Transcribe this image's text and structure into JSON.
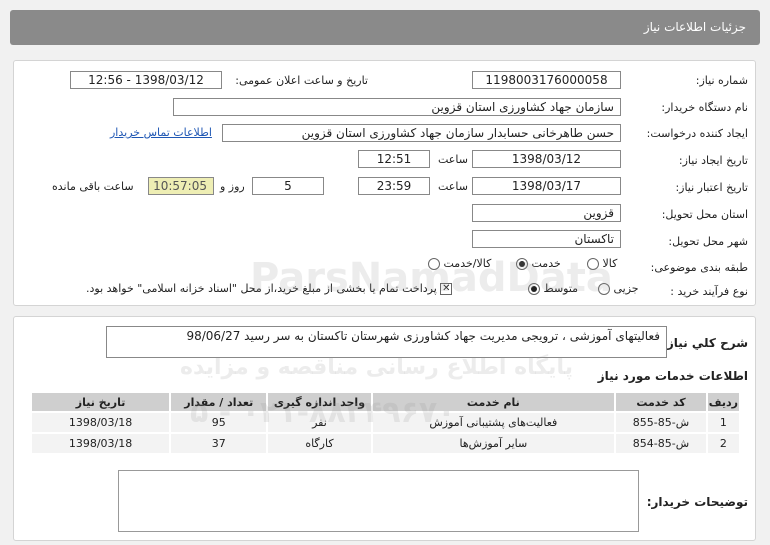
{
  "header": {
    "title": "جزئیات اطلاعات نیاز"
  },
  "info": {
    "need_number_label": "شماره نیاز:",
    "need_number": "1198003176000058",
    "announce_label": "تاریخ و ساعت اعلان عمومی:",
    "announce_value": "1398/03/12 - 12:56",
    "buyer_org_label": "نام دستگاه خریدار:",
    "buyer_org": "سازمان جهاد کشاورزی استان قزوین",
    "creator_label": "ایجاد کننده درخواست:",
    "creator": "حسن طاهرخانی حسابدار سازمان جهاد کشاورزی استان قزوین",
    "contact_link": "اطلاعات تماس خریدار",
    "created_label": "تاریخ ایجاد نیاز:",
    "created_date": "1398/03/12",
    "time_label": "ساعت",
    "created_time": "12:51",
    "valid_label": "تاریخ اعتبار نیاز:",
    "valid_date": "1398/03/17",
    "valid_time": "23:59",
    "days": "5",
    "days_and": "روز و",
    "remaining_time": "10:57:05",
    "remaining_label": "ساعت باقی مانده",
    "province_label": "استان محل تحویل:",
    "province": "قزوین",
    "city_label": "شهر محل تحویل:",
    "city": "تاکستان",
    "category_label": "طبقه بندی موضوعی:",
    "category_options": [
      "کالا",
      "خدمت",
      "کالا/خدمت"
    ],
    "purchase_label": "نوع فرآیند خرید :",
    "purchase_options": [
      "جزیی",
      "متوسط"
    ],
    "payment_note": "پرداخت تمام یا بخشی از مبلغ خرید،از محل \"اسناد خزانه اسلامی\" خواهد بود."
  },
  "summary": {
    "label": "شرح کلي نياز:",
    "text": "فعالیتهای آموزشی ، ترویجی مدیریت جهاد کشاورزی شهرستان تاکستان به سر رسید 98/06/27"
  },
  "services": {
    "title": "اطلاعات خدمات مورد نیاز",
    "columns": [
      "ردیف",
      "کد خدمت",
      "نام خدمت",
      "واحد اندازه گیری",
      "تعداد / مقدار",
      "تاریخ نیاز"
    ],
    "rows": [
      [
        "1",
        "ش-85-855",
        "فعالیت‌های پشتیبانی آموزش",
        "نفر",
        "95",
        "1398/03/18"
      ],
      [
        "2",
        "ش-85-854",
        "سایر آموزش‌ها",
        "کارگاه",
        "37",
        "1398/03/18"
      ]
    ]
  },
  "buyer_notes": {
    "label": "توضیحات خریدار:"
  },
  "watermark": {
    "line1": "ParsNamadData",
    "line2": "پایگاه اطلاع رسانی مناقصه و مزایده",
    "line3": "۰۲۱-۸۸۳۴۹۶۷۰ - ۵"
  }
}
